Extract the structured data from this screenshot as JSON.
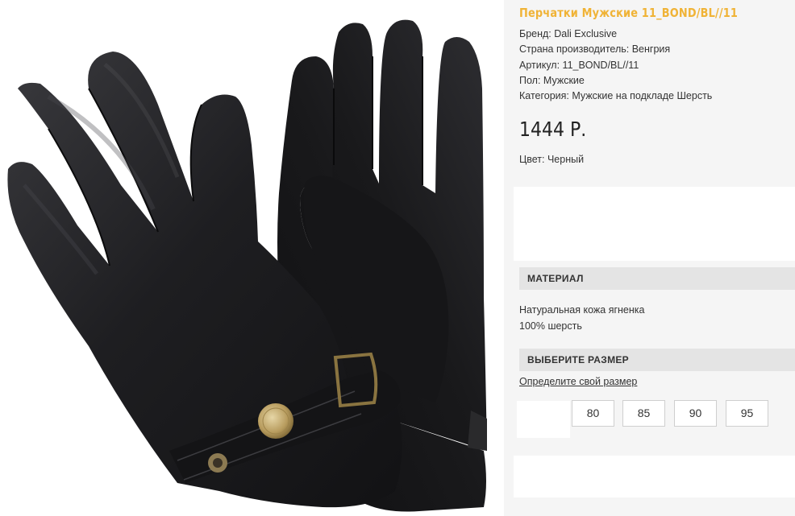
{
  "product": {
    "title": "Перчатки Мужские 11_BOND/BL//11",
    "brand": "Бренд: Dali Exclusive",
    "country": "Страна производитель: Венгрия",
    "article": "Артикул: 11_BOND/BL//11",
    "gender": "Пол: Мужские",
    "category": "Категория: Мужские на подкладе Шерсть",
    "price": "1444 Р.",
    "color": "Цвет: Черный",
    "image_icon": "product-photo-gloves"
  },
  "material": {
    "header": "МАТЕРИАЛ",
    "line1": "Натуральная кожа ягненка",
    "line2": "100% шерсть"
  },
  "size": {
    "header": "ВЫБЕРИТЕ РАЗМЕР",
    "link": "Определите свой размер",
    "options": [
      "80",
      "85",
      "90",
      "95"
    ]
  },
  "colors": {
    "title": "#f0b336",
    "panel": "#f5f5f5",
    "header_bg": "#e4e4e4",
    "leather": "#1c1c1e"
  }
}
